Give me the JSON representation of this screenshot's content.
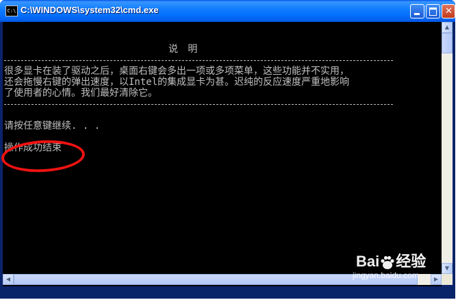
{
  "window": {
    "title": "C:\\WINDOWS\\system32\\cmd.exe",
    "icon": "cmd-icon",
    "controls": {
      "minimize_icon": "minimize-icon",
      "maximize_icon": "maximize-icon",
      "close_icon": "close-icon",
      "close_glyph": "✕"
    }
  },
  "console": {
    "heading": "说 明",
    "divider": "------------------------------------------------------------------------------",
    "lines": [
      "很多显卡在装了驱动之后，桌面右键会多出一项或多项菜单，这些功能并不实用，",
      "还会拖慢右键的弹出速度，以Intel的集成显卡为甚。迟纯的反应速度严重地影响",
      "了使用者的心情。我们最好清除它。"
    ],
    "prompt": "请按任意键继续. . .",
    "result": "操作成功结束"
  },
  "colors": {
    "console_bg": "#000000",
    "console_text": "#c0c0c0",
    "titlebar": "#0a5fe6",
    "highlight_ring": "#ee1212"
  },
  "watermark": {
    "logo_text": "Bai",
    "logo_suffix": "经验",
    "url": "jingyan.baidu.com"
  }
}
